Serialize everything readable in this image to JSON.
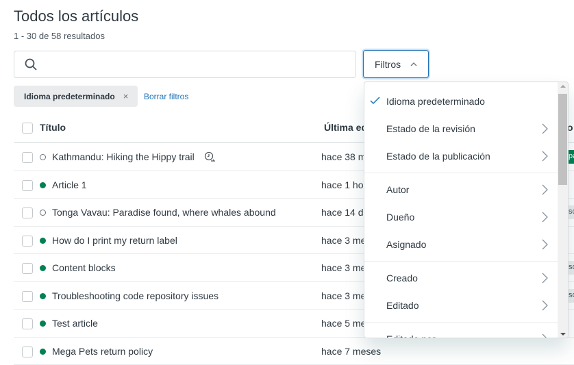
{
  "page": {
    "title": "Todos los artículos",
    "results": "1 - 30 de 58 resultados"
  },
  "search": {
    "placeholder": "",
    "value": ""
  },
  "filters_button": {
    "label": "Filtros"
  },
  "active_filters": [
    {
      "label": "Idioma predeterminado",
      "remove": "×"
    }
  ],
  "clear_filters": "Borrar filtros",
  "table": {
    "columns": [
      "Título",
      "Última edición",
      "o"
    ],
    "rows": [
      {
        "title": "Kathmandu: Hiking the Hippy trail",
        "status": "draft",
        "time": "hace 38 m",
        "badge": "pa",
        "badge_color": "green",
        "scheduled": true
      },
      {
        "title": "Article 1",
        "status": "published",
        "time": "hace 1 ho",
        "badge": "",
        "badge_color": ""
      },
      {
        "title": "Tonga Vavau: Paradise found, where whales abound",
        "status": "draft",
        "time": "hace 14 d",
        "badge": "so",
        "badge_color": "grey"
      },
      {
        "title": "How do I print my return label",
        "status": "published",
        "time": "hace 3 me",
        "badge": "",
        "badge_color": ""
      },
      {
        "title": "Content blocks",
        "status": "published",
        "time": "hace 3 me",
        "badge": "so",
        "badge_color": "grey"
      },
      {
        "title": "Troubleshooting code repository issues",
        "status": "published",
        "time": "hace 3 me",
        "badge": "so",
        "badge_color": "grey"
      },
      {
        "title": "Test article",
        "status": "published",
        "time": "hace 5 me",
        "badge": "",
        "badge_color": ""
      },
      {
        "title": "Mega Pets return policy",
        "status": "published",
        "time": "hace 7 meses",
        "badge": "",
        "badge_color": ""
      }
    ]
  },
  "filter_menu": {
    "items": [
      {
        "label": "Idioma predeterminado",
        "checked": true
      },
      {
        "label": "Estado de la revisión",
        "submenu": true
      },
      {
        "label": "Estado de la publicación",
        "submenu": true
      },
      {
        "label": "Autor",
        "submenu": true
      },
      {
        "label": "Dueño",
        "submenu": true
      },
      {
        "label": "Asignado",
        "submenu": true
      },
      {
        "label": "Creado",
        "submenu": true
      },
      {
        "label": "Editado",
        "submenu": true
      },
      {
        "label": "Editado por",
        "submenu": true
      }
    ]
  },
  "colors": {
    "accent": "#1f73b7",
    "published": "#038153"
  }
}
